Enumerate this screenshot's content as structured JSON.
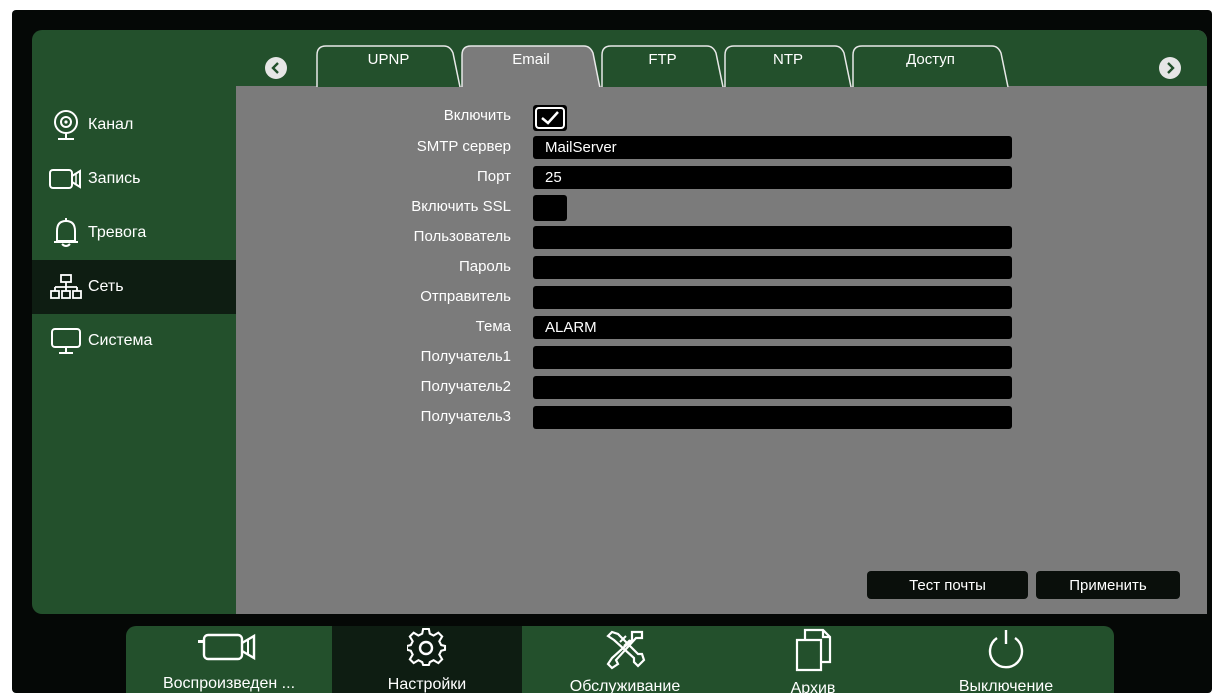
{
  "sidebar": {
    "items": [
      {
        "label": "Канал",
        "icon": "camera-icon"
      },
      {
        "label": "Запись",
        "icon": "video-camera-icon"
      },
      {
        "label": "Тревога",
        "icon": "bell-icon"
      },
      {
        "label": "Сеть",
        "icon": "network-icon"
      },
      {
        "label": "Система",
        "icon": "monitor-icon"
      }
    ],
    "active": "Сеть"
  },
  "tabs": {
    "items": [
      "UPNP",
      "Email",
      "FTP",
      "NTP",
      "Доступ"
    ],
    "active": "Email",
    "prev_icon": "chevron-left-icon",
    "next_icon": "chevron-right-icon"
  },
  "form": {
    "enable_label": "Включить",
    "enable_checked": true,
    "smtp_label": "SMTP сервер",
    "smtp_value": "MailServer",
    "port_label": "Порт",
    "port_value": "25",
    "ssl_label": "Включить SSL",
    "ssl_checked": false,
    "user_label": "Пользователь",
    "user_value": "",
    "password_label": "Пароль",
    "password_value": "",
    "sender_label": "Отправитель",
    "sender_value": "",
    "subject_label": "Тема",
    "subject_value": "ALARM",
    "recipient1_label": "Получатель1",
    "recipient1_value": "",
    "recipient2_label": "Получатель2",
    "recipient2_value": "",
    "recipient3_label": "Получатель3",
    "recipient3_value": ""
  },
  "buttons": {
    "test_mail": "Тест почты",
    "apply": "Применить"
  },
  "bottombar": {
    "items": [
      {
        "label": "Воспроизведен ...",
        "icon": "video-camera-icon"
      },
      {
        "label": "Настройки",
        "icon": "gear-icon"
      },
      {
        "label": "Обслуживание",
        "icon": "tools-icon"
      },
      {
        "label": "Архив",
        "icon": "files-icon"
      },
      {
        "label": "Выключение",
        "icon": "power-icon"
      }
    ],
    "active": "Настройки"
  },
  "colors": {
    "panel_green": "#23502c",
    "active_dark": "#0e1d12",
    "content_gray": "#7b7b7b",
    "field_black": "#000000"
  }
}
